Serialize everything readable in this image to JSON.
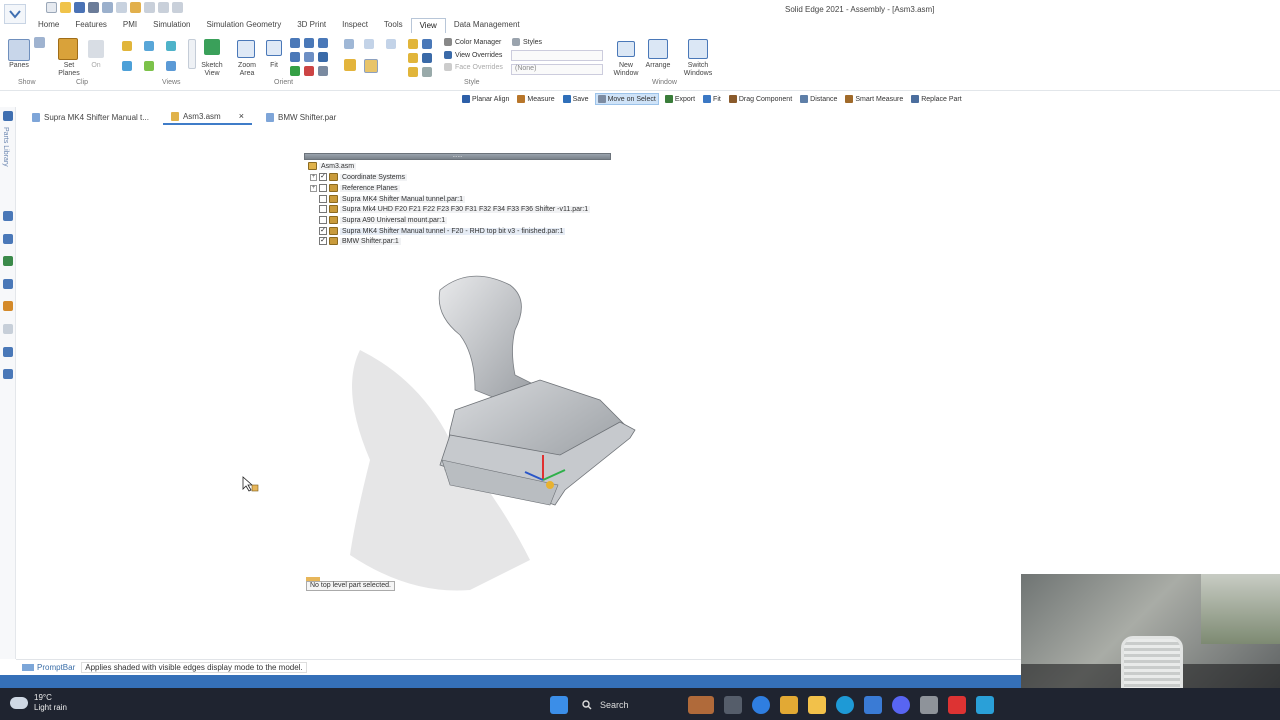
{
  "window": {
    "title": "Solid Edge 2021 - Assembly - [Asm3.asm]"
  },
  "ribbon": {
    "tabs": [
      "Home",
      "Features",
      "PMI",
      "Simulation",
      "Simulation Geometry",
      "3D Print",
      "Inspect",
      "Tools",
      "View",
      "Data Management"
    ],
    "active_tab": "View",
    "panes_label": "Panes",
    "show_group": "Show",
    "set_planes_label": "Set\nPlanes",
    "on_label": "On",
    "clip_group": "Clip",
    "sketch_view_label": "Sketch\nView",
    "views_group": "Views",
    "zoom_area_label": "Zoom\nArea",
    "fit_label": "Fit",
    "orient_group": "Orient",
    "color_manager": "Color Manager",
    "styles": "Styles",
    "view_overrides": "View Overrides",
    "face_overrides": "Face Overrides",
    "overrides_value": "(None)",
    "style_group": "Style",
    "new_window_label": "New\nWindow",
    "arrange_label": "Arrange",
    "switch_windows_label": "Switch\nWindows",
    "window_group": "Window"
  },
  "command_bar": [
    {
      "label": "Planar Align",
      "color": "#2d5fa8",
      "active": false
    },
    {
      "label": "Measure",
      "color": "#b8762a",
      "active": false
    },
    {
      "label": "Save",
      "color": "#2f6fb9",
      "active": false
    },
    {
      "label": "Move on Select",
      "color": "#7c8ba1",
      "active": true
    },
    {
      "label": "Export",
      "color": "#3a7d3a",
      "active": false
    },
    {
      "label": "Fit",
      "color": "#3b78c4",
      "active": false
    },
    {
      "label": "Drag Component",
      "color": "#8a5a2b",
      "active": false
    },
    {
      "label": "Distance",
      "color": "#5e7fa8",
      "active": false
    },
    {
      "label": "Smart Measure",
      "color": "#a06a2a",
      "active": false
    },
    {
      "label": "Replace Part",
      "color": "#4b6e9e",
      "active": false
    }
  ],
  "doc_tabs": [
    {
      "label": "Supra MK4 Shifter Manual t...",
      "active": false
    },
    {
      "label": "Asm3.asm",
      "active": true
    },
    {
      "label": "BMW Shifter.par",
      "active": false
    }
  ],
  "close_glyph": "×",
  "left_panel_label": "Parts Library",
  "tree": {
    "root": "Asm3.asm",
    "items": [
      {
        "label": "Coordinate Systems",
        "expand": "+",
        "checked": "✓"
      },
      {
        "label": "Reference Planes",
        "expand": "+",
        "checked": ""
      },
      {
        "label": "Supra MK4 Shifter Manual tunnel.par:1",
        "expand": "",
        "checked": ""
      },
      {
        "label": "Supra Mk4 UHD F20 F21 F22 F23 F30 F31 F32 F34 F33 F36 Shifter -v11.par:1",
        "expand": "",
        "checked": ""
      },
      {
        "label": "Supra A90 Universal mount.par:1",
        "expand": "",
        "checked": ""
      },
      {
        "label": "Supra MK4 Shifter Manual tunnel - F20 - RHD top bit v3 - finished.par:1",
        "expand": "",
        "checked": "✓"
      },
      {
        "label": "BMW Shifter.par:1",
        "expand": "",
        "checked": "✓"
      }
    ]
  },
  "status_tip": "No top level part selected.",
  "prompt_bar": {
    "tab_label": "PromptBar",
    "message": "Applies shaded with visible edges display mode to the model."
  },
  "taskbar": {
    "temperature": "19°C",
    "weather": "Light rain",
    "search_label": "Search"
  }
}
